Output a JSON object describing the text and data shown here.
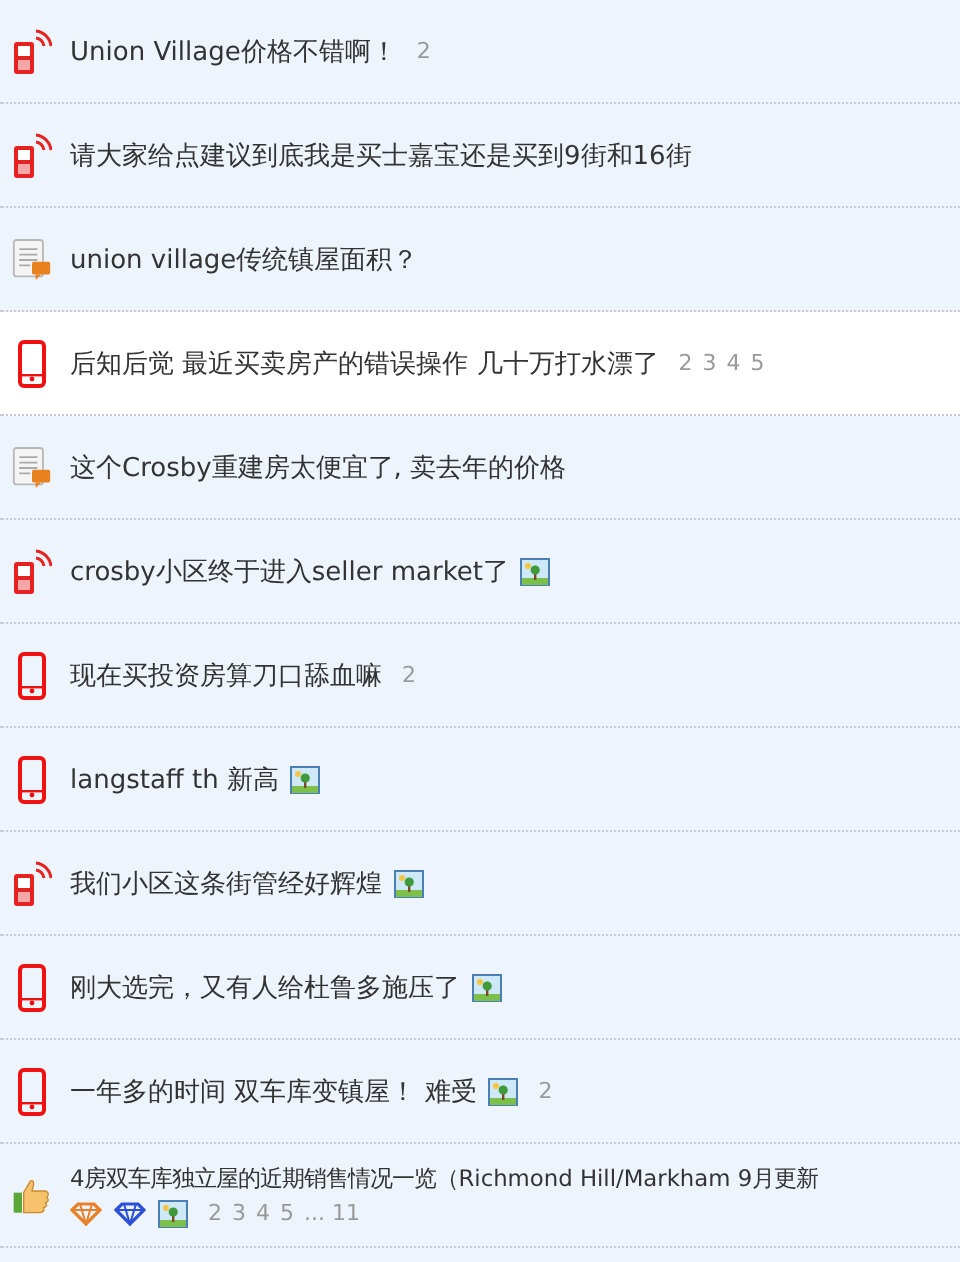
{
  "threads": [
    {
      "kind": "phone-signal",
      "title": "Union Village价格不错啊！",
      "has_image": false,
      "pages": [
        "2"
      ],
      "selected": false
    },
    {
      "kind": "phone-signal",
      "title": "请大家给点建议到底我是买士嘉宝还是买到9街和16街",
      "has_image": false,
      "selected": false
    },
    {
      "kind": "document",
      "title": "union village传统镇屋面积？",
      "has_image": false,
      "selected": false
    },
    {
      "kind": "phone",
      "title": "后知后觉 最近买卖房产的错误操作 几十万打水漂了",
      "has_image": false,
      "pages": [
        "2",
        "3",
        "4",
        "5"
      ],
      "selected": true
    },
    {
      "kind": "document",
      "title": "这个Crosby重建房太便宜了, 卖去年的价格",
      "has_image": false,
      "selected": false
    },
    {
      "kind": "phone-signal",
      "title": "crosby小区终于进入seller market了",
      "has_image": true,
      "selected": false
    },
    {
      "kind": "phone",
      "title": "现在买投资房算刀口舔血嘛",
      "has_image": false,
      "pages": [
        "2"
      ],
      "selected": false
    },
    {
      "kind": "phone",
      "title": "langstaff th 新高",
      "has_image": true,
      "selected": false
    },
    {
      "kind": "phone-signal",
      "title": "我们小区这条街管经好辉煌",
      "has_image": true,
      "selected": false
    },
    {
      "kind": "phone",
      "title": "刚大选完，又有人给杜鲁多施压了",
      "has_image": true,
      "selected": false
    },
    {
      "kind": "phone",
      "title": "一年多的时间 双车库变镇屋！ 难受",
      "has_image": true,
      "pages": [
        "2"
      ],
      "selected": false
    },
    {
      "kind": "thumb",
      "title": "4房双车库独立屋的近期销售情况一览（Richmond Hill/Markham 9月更新",
      "badges": [
        {
          "color": "#e8802a"
        },
        {
          "color": "#2a4fd8"
        }
      ],
      "has_image": true,
      "pages": [
        "2",
        "3",
        "4",
        "5",
        "... 11"
      ],
      "selected": false
    }
  ]
}
